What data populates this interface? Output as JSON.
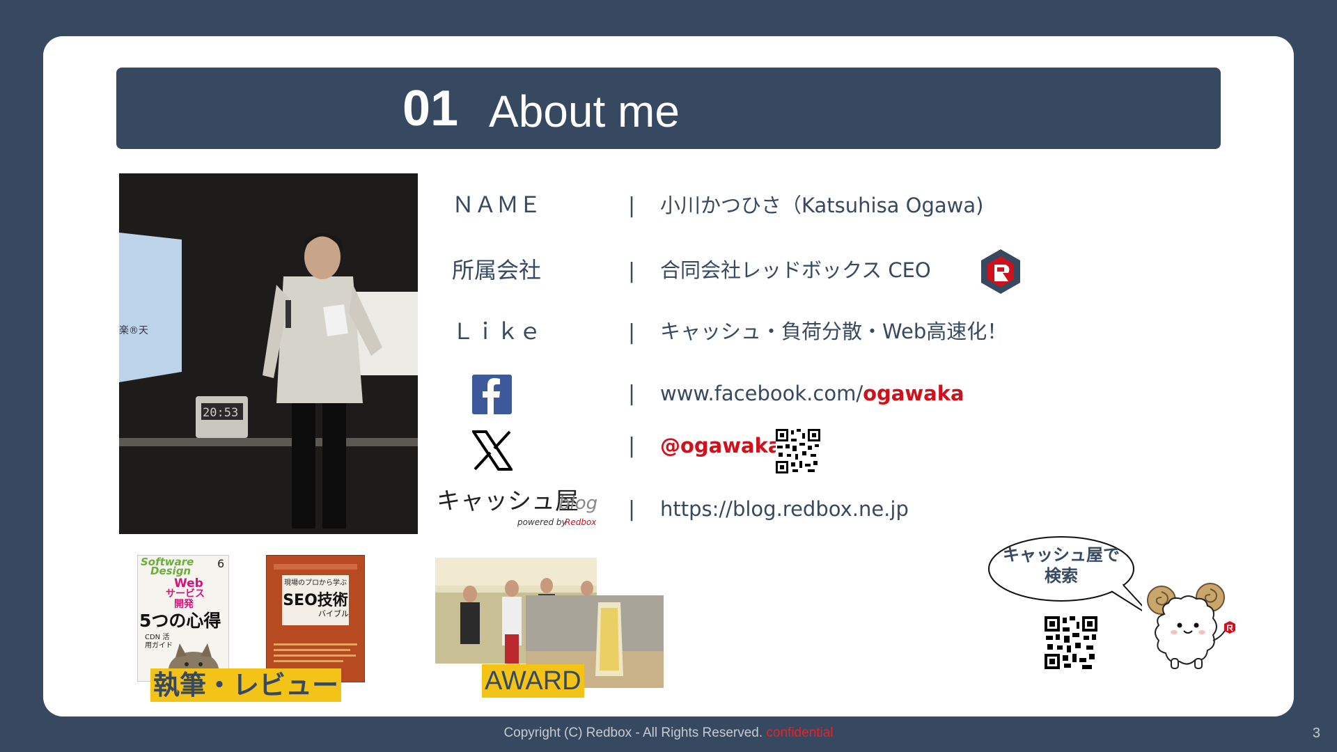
{
  "slide": {
    "number": "01",
    "title": "About me",
    "page_number": "3"
  },
  "profile": {
    "rows": [
      {
        "label": "ＮＡＭＥ",
        "value": "小川かつひさ（Katsuhisa Ogawa)"
      },
      {
        "label": "所属会社",
        "value": "合同会社レッドボックス CEO"
      },
      {
        "label": "Ｌｉｋｅ",
        "value": "キャッシュ・負荷分散・Web高速化！"
      }
    ],
    "facebook": {
      "prefix": "www.facebook.com/",
      "handle": "ogawaka"
    },
    "x": {
      "handle": "@ogawaka"
    },
    "blog": {
      "logo_main": "キャッシュ屋",
      "logo_sub": "blog",
      "logo_powered": "powered by",
      "logo_brand": "Redbox",
      "url": "https://blog.redbox.ne.jp"
    },
    "separator": "|"
  },
  "books": {
    "book1": {
      "line1": "Software",
      "line2": "Design",
      "issue": "6",
      "lines": [
        "Web",
        "サービス",
        "開発",
        "5つの心得"
      ],
      "sub": "CDN 活用ガイド"
    },
    "book2": {
      "title": "現場のプロから学ぶ",
      "main": "SEO技術",
      "sub": "バイブル"
    },
    "tag": "執筆・レビュー"
  },
  "award": {
    "tag": "AWARD"
  },
  "mascot": {
    "bubble_line1": "キャッシュ屋で",
    "bubble_line2": "検索"
  },
  "photo": {
    "clock": "20:53",
    "screen_text": "楽®天"
  },
  "footer": {
    "copyright": "Copyright (C) Redbox - All Rights Reserved.",
    "confidential": "confidential"
  },
  "colors": {
    "navy": "#364960",
    "red": "#d0101a",
    "yellow": "#f3c417",
    "background": "#364960"
  }
}
